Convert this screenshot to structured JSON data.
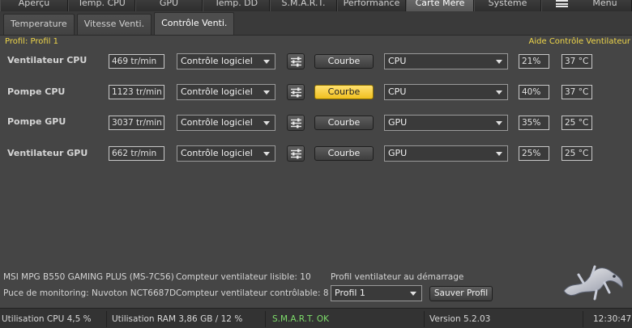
{
  "top_tabs": [
    {
      "label": "Aperçu",
      "active": false
    },
    {
      "label": "Temp. CPU",
      "active": false
    },
    {
      "label": "GPU",
      "active": false
    },
    {
      "label": "Temp. DD",
      "active": false
    },
    {
      "label": "S.M.A.R.T.",
      "active": false
    },
    {
      "label": "Performance",
      "active": false
    },
    {
      "label": "Carte Mère",
      "active": true
    },
    {
      "label": "Système",
      "active": false
    }
  ],
  "menu_label": "Menu",
  "sub_tabs": [
    {
      "label": "Temperature",
      "active": false
    },
    {
      "label": "Vitesse Venti.",
      "active": false
    },
    {
      "label": "Contrôle Venti.",
      "active": true
    }
  ],
  "profile_label": "Profil: Profil 1",
  "help_link": "Aide Contrôle Ventilateur",
  "fans": [
    {
      "name": "Ventilateur CPU",
      "rpm": "469 tr/min",
      "mode": "Contrôle logiciel",
      "curve_label": "Courbe",
      "curve_active": false,
      "source": "CPU",
      "percent": "21%",
      "temp": "37 °C"
    },
    {
      "name": "Pompe CPU",
      "rpm": "1123 tr/min",
      "mode": "Contrôle logiciel",
      "curve_label": "Courbe",
      "curve_active": true,
      "source": "CPU",
      "percent": "40%",
      "temp": "37 °C"
    },
    {
      "name": "Pompe GPU",
      "rpm": "3037 tr/min",
      "mode": "Contrôle logiciel",
      "curve_label": "Courbe",
      "curve_active": false,
      "source": "GPU",
      "percent": "35%",
      "temp": "25 °C"
    },
    {
      "name": "Ventilateur GPU",
      "rpm": "662 tr/min",
      "mode": "Contrôle logiciel",
      "curve_label": "Courbe",
      "curve_active": false,
      "source": "GPU",
      "percent": "25%",
      "temp": "25 °C"
    }
  ],
  "info": {
    "board": "MSI MPG B550 GAMING PLUS (MS-7C56)",
    "chip": "Puce de monitoring: Nuvoton NCT6687D",
    "fan_count_readable": "Compteur ventilateur lisible: 10",
    "fan_count_controllable": "Compteur ventilateur contrôlable: 8",
    "startup_profile_label": "Profil ventilateur au démarrage",
    "startup_profile_value": "Profil 1",
    "save_profile_label": "Sauver Profil"
  },
  "status": {
    "cpu": "Utilisation CPU 4,5 %",
    "ram": "Utilisation RAM 3,86 GB / 12 %",
    "smart": "S.M.A.R.T. OK",
    "version": "Version 5.2.03",
    "time": "12:30:47"
  },
  "colors": {
    "accent_yellow": "#f0d74a",
    "curve_active": "#f0c020",
    "smart_ok": "#7ddc6a",
    "background": "#454545"
  },
  "icons": {
    "settings": "sliders-icon",
    "menu": "hamburger-icon",
    "logo": "salamander-logo"
  }
}
